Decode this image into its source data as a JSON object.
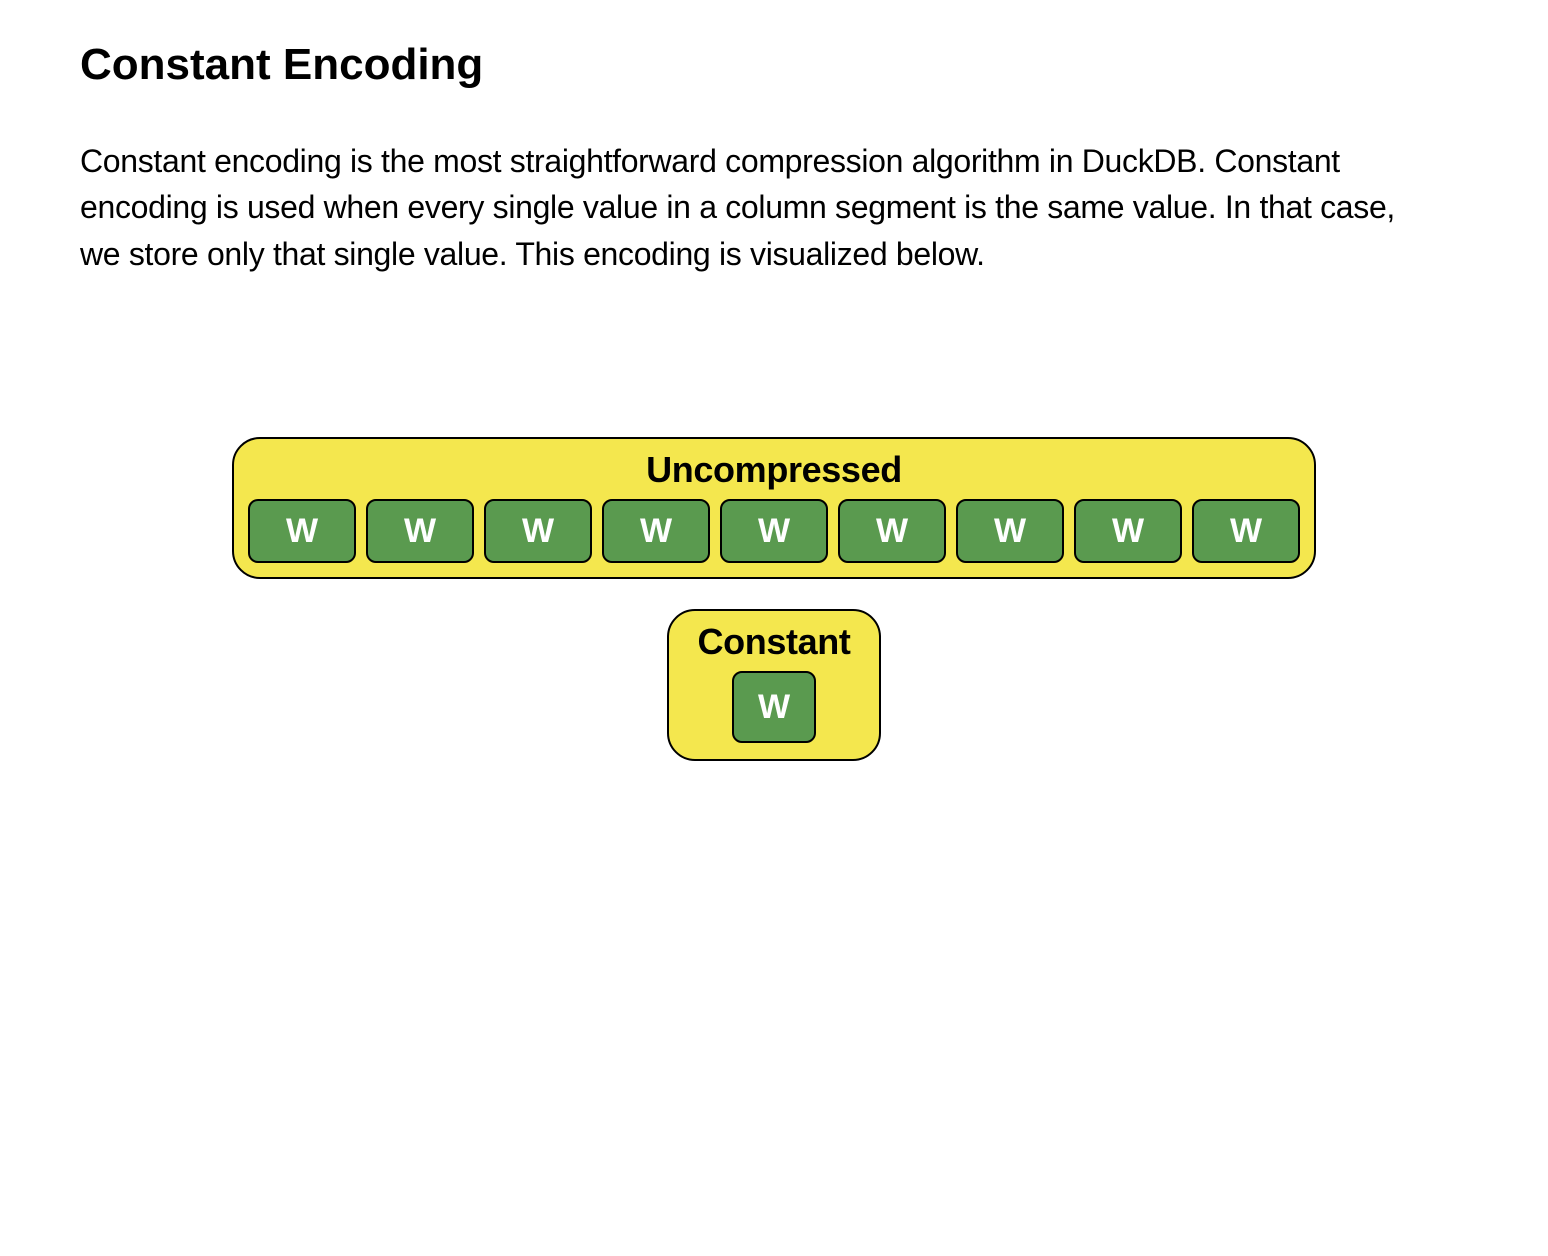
{
  "heading": "Constant Encoding",
  "paragraph": "Constant encoding is the most straightforward compression algorithm in DuckDB. Constant encoding is used when every single value in a column segment is the same value. In that case, we store only that single value. This encoding is visualized below.",
  "diagram": {
    "uncompressed": {
      "label": "Uncompressed",
      "cells": [
        "W",
        "W",
        "W",
        "W",
        "W",
        "W",
        "W",
        "W",
        "W"
      ]
    },
    "constant": {
      "label": "Constant",
      "cells": [
        "W"
      ]
    }
  },
  "colors": {
    "box_bg": "#f4e74e",
    "cell_bg": "#5a9a4f",
    "cell_text": "#ffffff",
    "border": "#000000"
  }
}
